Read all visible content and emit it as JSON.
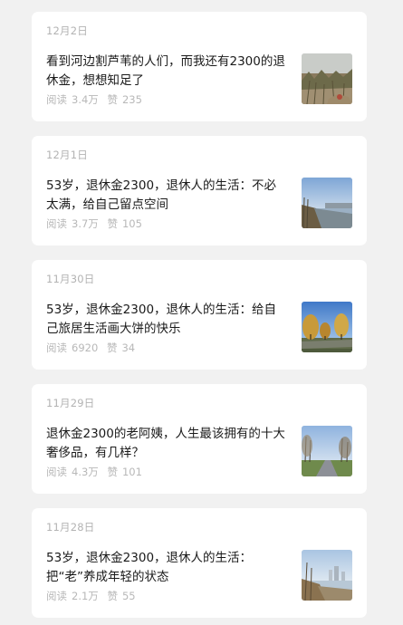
{
  "articles": [
    {
      "date": "12月2日",
      "title": "看到河边割芦苇的人们，而我还有2300的退休金，想想知足了",
      "reads_label": "阅读",
      "reads": "3.4万",
      "likes_label": "赞",
      "likes": "235",
      "thumb_icon": "reed-field-photo"
    },
    {
      "date": "12月1日",
      "title": "53岁，退休金2300，退休人的生活：不必太满，给自己留点空间",
      "reads_label": "阅读",
      "reads": "3.7万",
      "likes_label": "赞",
      "likes": "105",
      "thumb_icon": "riverside-sky-photo"
    },
    {
      "date": "11月30日",
      "title": "53岁，退休金2300，退休人的生活：给自己旅居生活画大饼的快乐",
      "reads_label": "阅读",
      "reads": "6920",
      "likes_label": "赞",
      "likes": "34",
      "thumb_icon": "park-trees-photo"
    },
    {
      "date": "11月29日",
      "title": "退休金2300的老阿姨，人生最该拥有的十大奢侈品，有几样？",
      "reads_label": "阅读",
      "reads": "4.3万",
      "likes_label": "赞",
      "likes": "101",
      "thumb_icon": "road-trees-photo"
    },
    {
      "date": "11月28日",
      "title": "53岁，退休金2300，退休人的生活：把“老”养成年轻的状态",
      "reads_label": "阅读",
      "reads": "2.1万",
      "likes_label": "赞",
      "likes": "55",
      "thumb_icon": "river-city-photo"
    }
  ]
}
